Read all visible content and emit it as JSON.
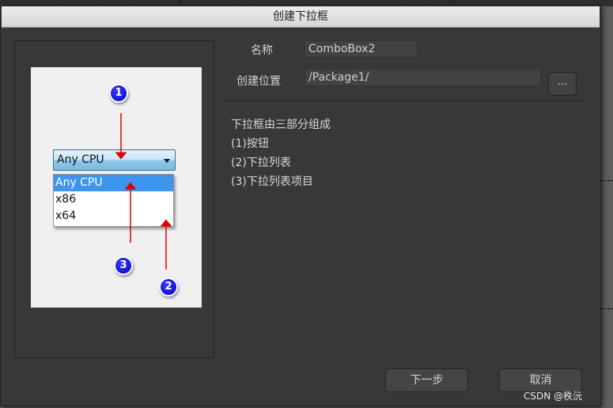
{
  "dialog": {
    "title": "创建下拉框"
  },
  "preview": {
    "combo_value": "Any CPU",
    "list_items": [
      "Any CPU",
      "x86",
      "x64"
    ],
    "selected_index": 0,
    "badges": [
      "1",
      "2",
      "3"
    ],
    "accent_color": "#3d95ee",
    "badge_color": "#0000c8",
    "arrow_color": "#e00000"
  },
  "form": {
    "name_label": "名称",
    "name_value": "ComboBox2",
    "location_label": "创建位置",
    "location_value": "/Package1/",
    "browse_label": "..."
  },
  "description": {
    "lines": [
      "下拉框由三部分组成",
      "(1)按钮",
      "(2)下拉列表",
      "(3)下拉列表项目"
    ]
  },
  "buttons": {
    "next_label": "下一步",
    "cancel_label": "取消"
  },
  "watermark": "CSDN @秩沅"
}
